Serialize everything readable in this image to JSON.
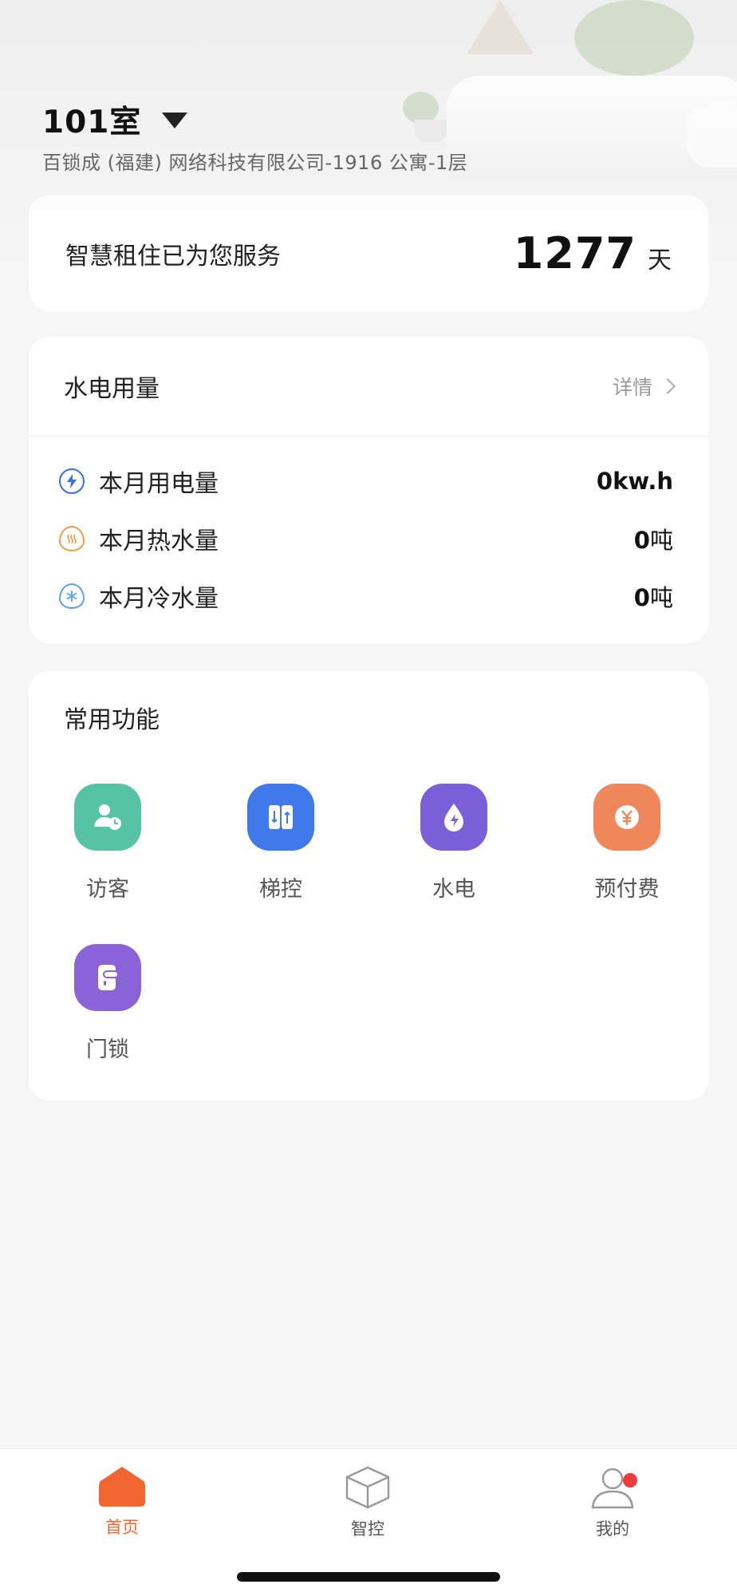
{
  "header": {
    "room": "101室",
    "address": "百锁成 (福建) 网络科技有限公司-1916 公寓-1层"
  },
  "service": {
    "label": "智慧租住已为您服务",
    "days": "1277",
    "unit": "天"
  },
  "usage": {
    "title": "水电用量",
    "detail_label": "详情",
    "rows": [
      {
        "icon": "lightning-icon",
        "label": "本月用电量",
        "value": "0",
        "unit": "kw.h"
      },
      {
        "icon": "hot-water-icon",
        "label": "本月热水量",
        "value": "0",
        "unit": "吨"
      },
      {
        "icon": "cold-water-icon",
        "label": "本月冷水量",
        "value": "0",
        "unit": "吨"
      }
    ]
  },
  "functions": {
    "title": "常用功能",
    "items": [
      {
        "label": "访客",
        "icon": "visitor-icon",
        "color": "#56c2a6"
      },
      {
        "label": "梯控",
        "icon": "elevator-icon",
        "color": "#3f78e8"
      },
      {
        "label": "水电",
        "icon": "utilities-icon",
        "color": "#7b5fd8"
      },
      {
        "label": "预付费",
        "icon": "prepay-icon",
        "color": "#f0875a"
      },
      {
        "label": "门锁",
        "icon": "door-lock-icon",
        "color": "#8a63d8"
      }
    ]
  },
  "tabbar": {
    "items": [
      {
        "label": "首页",
        "icon": "home-icon",
        "active": true
      },
      {
        "label": "智控",
        "icon": "cube-icon",
        "active": false
      },
      {
        "label": "我的",
        "icon": "profile-icon",
        "active": false,
        "badge": true
      }
    ]
  },
  "colors": {
    "accent": "#ef6631",
    "badge": "#ee3b3b"
  }
}
